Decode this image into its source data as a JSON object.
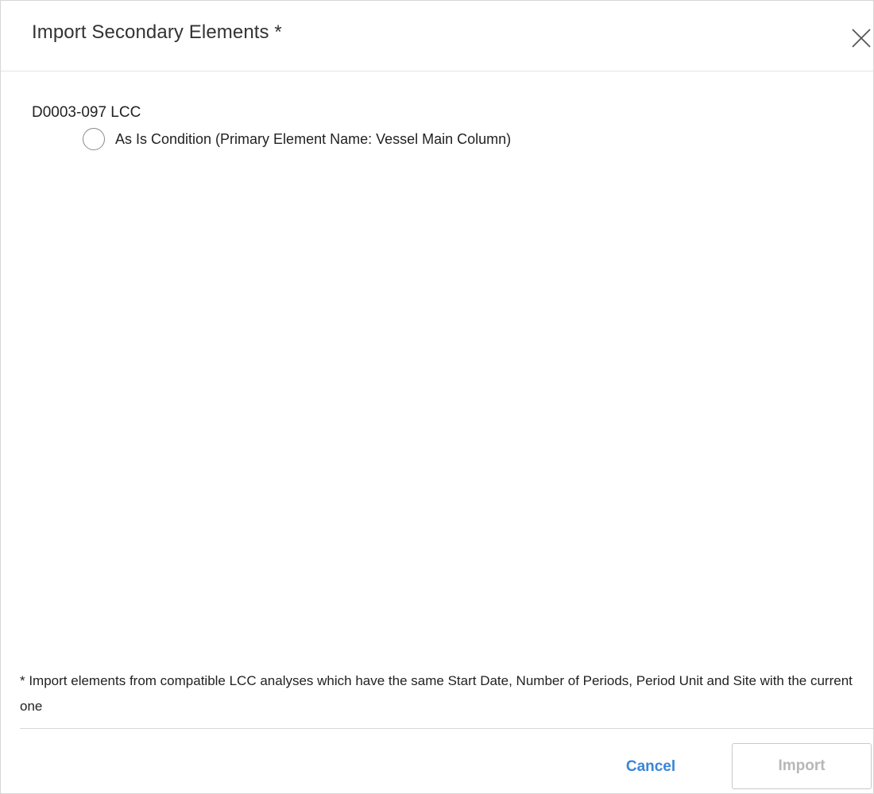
{
  "dialog": {
    "title": "Import Secondary Elements *",
    "close_icon": "close-icon"
  },
  "analysis": {
    "name": "D0003-097 LCC",
    "elements": [
      {
        "label": "As Is Condition (Primary Element Name: Vessel Main Column)",
        "selected": false
      }
    ]
  },
  "footnote": "* Import elements from compatible LCC analyses which have the same Start Date, Number of Periods, Period Unit and Site with the current one",
  "buttons": {
    "cancel_label": "Cancel",
    "import_label": "Import",
    "import_enabled": false
  },
  "colors": {
    "accent": "#3a86d6",
    "disabled_text": "#b7b7b7",
    "border": "#d6d6d6"
  }
}
